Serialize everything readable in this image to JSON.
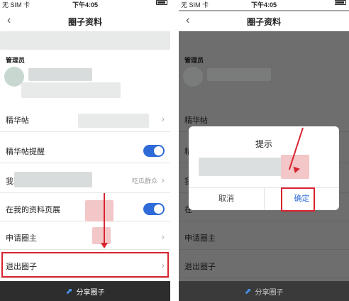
{
  "status_bar": {
    "carrier": "无 SIM 卡",
    "time": "下午4:05"
  },
  "nav": {
    "back_icon": "‹",
    "title": "圈子资料"
  },
  "admin_label": "管理员",
  "left": {
    "rows": {
      "digest_posts": "精华帖",
      "digest_reminder": "精华帖提醒",
      "my_alias_prefix": "我",
      "my_alias_value": "吃瓜群众",
      "show_on_profile": "在我的资料页展",
      "apply_owner": "申请圈主",
      "quit_circle": "退出圈子"
    },
    "share": "分享圈子"
  },
  "right": {
    "rows": {
      "digest_posts": "精华帖",
      "digest_reminder_partial": "精华",
      "my_alias_prefix": "我",
      "show_on_profile_partial": "在",
      "apply_owner": "申请圈主",
      "quit_circle": "退出圈子"
    },
    "dialog": {
      "title": "提示",
      "cancel": "取消",
      "confirm": "确定"
    },
    "share": "分享圈子"
  },
  "colors": {
    "accent": "#2f6bd8",
    "highlight": "#d7242f",
    "bottom_bar": "#2d2d2d"
  },
  "icons": {
    "share": "share-icon",
    "back": "chevron-left-icon",
    "chevron": "chevron-right-icon"
  }
}
